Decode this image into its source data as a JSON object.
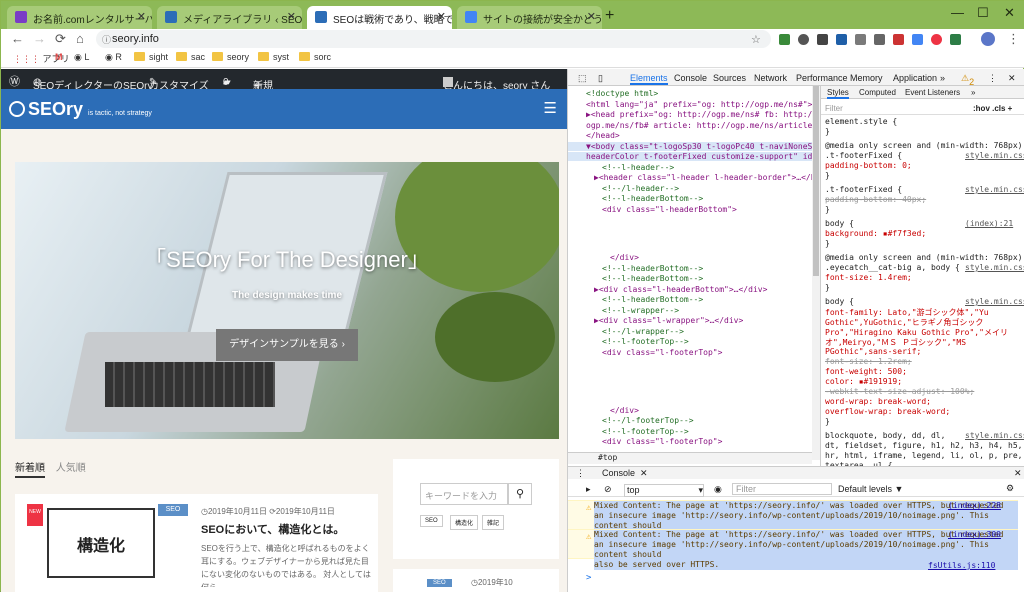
{
  "browser": {
    "tabs": [
      {
        "title": "お名前.comレンタルサーバー コント",
        "favicon_color": "#7a3cc6"
      },
      {
        "title": "メディアライブラリ ‹ SEOディレクター",
        "favicon_color": "#2c6db7"
      },
      {
        "title": "SEOは戦術であり、戦略ではない。",
        "favicon_color": "#2c6db7",
        "active": true
      },
      {
        "title": "サイトの接続が安全かどうかを確認",
        "favicon_color": "#4285f4"
      }
    ],
    "url": "seory.info",
    "bookmarks": [
      "アプリ",
      "M",
      "L",
      "R",
      "sight",
      "sac",
      "seory",
      "syst",
      "sorc"
    ]
  },
  "site": {
    "admin_bar": {
      "site_name": "SEOディレクターのSEOry",
      "customize": "カスタマイズ",
      "comments": "0",
      "new": "新規",
      "greeting": "こんにちは、seory さん"
    },
    "logo": "SEOry",
    "logo_tagline": "is tactic, not strategy",
    "hero": {
      "title": "「SEOry For The Designer」",
      "subtitle": "The design makes time",
      "button": "デザインサンプルを見る"
    },
    "feed_tabs": [
      "新着順",
      "人気順"
    ],
    "post": {
      "badge": "NEW",
      "category": "SEO",
      "date1": "2019年10月11日",
      "date2": "2019年10月11日",
      "title": "SEOにおいて、構造化とは。",
      "excerpt": "SEOを行う上で、構造化と呼ばれるものをよく耳にする。ウェブデザイナーから見れば見た目にない変化のないものではある。 対人としては何ら",
      "thumb_text": "構造化"
    },
    "sidebar": {
      "search_placeholder": "キーワードを入力",
      "tags": [
        "SEO",
        "構造化",
        "雑記"
      ],
      "date": "2019年10",
      "category": "SEO"
    }
  },
  "devtools": {
    "tabs": [
      "Elements",
      "Console",
      "Sources",
      "Network",
      "Performance",
      "Memory",
      "Application"
    ],
    "warning_count": "2",
    "dom_lines": [
      {
        "t": "<!doctype html>",
        "c": true,
        "i": 0
      },
      {
        "t": "<html lang=\"ja\" prefix=\"og: http://ogp.me/ns#\">",
        "i": 0
      },
      {
        "t": "▶<head prefix=\"og: http://ogp.me/ns# fb: http://",
        "i": 0
      },
      {
        "t": "ogp.me/ns/fb# article: http://ogp.me/ns/article#\">…",
        "i": 0
      },
      {
        "t": "</head>",
        "i": 0
      },
      {
        "t": "▼<body class=\"t-logoSp30 t-logoPc40 t-naviNoneSp t-",
        "i": 0,
        "sel": true
      },
      {
        "t": "headerColor t-footerFixed customize-support\" id=\"top\">",
        "i": 0,
        "sel": true
      },
      {
        "t": "<!--l-header-->",
        "c": true,
        "i": 2
      },
      {
        "t": "▶<header class=\"l-header l-header-border\">…</header>",
        "i": 1
      },
      {
        "t": "<!--/l-header-->",
        "c": true,
        "i": 2
      },
      {
        "t": "<!--l-headerBottom-->",
        "c": true,
        "i": 2
      },
      {
        "t": "<div class=\"l-headerBottom\">",
        "i": 2
      },
      {
        "t": "</div>",
        "i": 3,
        "gap": 4
      },
      {
        "t": "<!--l-headerBottom-->",
        "c": true,
        "i": 2
      },
      {
        "t": "<!--l-headerBottom-->",
        "c": true,
        "i": 2
      },
      {
        "t": "▶<div class=\"l-headerBottom\">…</div>",
        "i": 1
      },
      {
        "t": "<!--l-headerBottom-->",
        "c": true,
        "i": 2
      },
      {
        "t": "<!--l-wrapper-->",
        "c": true,
        "i": 2
      },
      {
        "t": "▶<div class=\"l-wrapper\">…</div>",
        "i": 1
      },
      {
        "t": "<!--/l-wrapper-->",
        "c": true,
        "i": 2
      },
      {
        "t": "<!--l-footerTop-->",
        "c": true,
        "i": 2
      },
      {
        "t": "<div class=\"l-footerTop\">",
        "i": 2
      },
      {
        "t": "</div>",
        "i": 3,
        "gap": 5
      },
      {
        "t": "<!--/l-footerTop-->",
        "c": true,
        "i": 2
      },
      {
        "t": "<!--l-footerTop-->",
        "c": true,
        "i": 2
      },
      {
        "t": "<div class=\"l-footerTop\">",
        "i": 2
      },
      {
        "t": "</div>",
        "i": 3,
        "gap": 2
      }
    ],
    "styles_tabs": [
      "Styles",
      "Computed",
      "Event Listeners"
    ],
    "filter_placeholder": "Filter",
    "filter_tools": ":hov .cls +",
    "styles_lines": [
      {
        "t": "element.style {",
        "k": "sel"
      },
      {
        "t": "}",
        "k": "sel"
      },
      {
        "t": "@media only screen and (min-width: 768px)",
        "k": "sel"
      },
      {
        "t": ".t-footerFixed {",
        "k": "sel",
        "src": "style.min.css:1"
      },
      {
        "t": "  padding-bottom: 0;",
        "k": "prop"
      },
      {
        "t": "}",
        "k": "sel"
      },
      {
        "t": ".t-footerFixed {",
        "k": "sel",
        "src": "style.min.css:1"
      },
      {
        "t": "  padding-bottom: 40px;",
        "k": "strike"
      },
      {
        "t": "}",
        "k": "sel"
      },
      {
        "t": "body {",
        "k": "sel",
        "src": "(index):21"
      },
      {
        "t": "  background: ▪#f7f3ed;",
        "k": "prop"
      },
      {
        "t": "}",
        "k": "sel"
      },
      {
        "t": "@media only screen and (min-width: 768px)",
        "k": "sel"
      },
      {
        "t": ".eyecatch__cat-big a, body {",
        "k": "sel",
        "src": "style.min.css:1"
      },
      {
        "t": "  font-size: 1.4rem;",
        "k": "prop"
      },
      {
        "t": "}",
        "k": "sel"
      },
      {
        "t": "body {",
        "k": "sel",
        "src": "style.min.css:1"
      },
      {
        "t": "  font-family: Lato,\"游ゴシック体\",\"Yu",
        "k": "prop"
      },
      {
        "t": "    Gothic\",YuGothic,\"ヒラギノ角ゴシック",
        "k": "prop"
      },
      {
        "t": "    Pro\",\"Hiragino Kaku Gothic Pro\",\"メイリ",
        "k": "prop"
      },
      {
        "t": "    オ\",Meiryo,\"ＭＳ Ｐゴシック\",\"MS",
        "k": "prop"
      },
      {
        "t": "    PGothic\",sans-serif;",
        "k": "prop"
      },
      {
        "t": "  font-size: 1.2rem;",
        "k": "strike"
      },
      {
        "t": "  font-weight: 500;",
        "k": "prop"
      },
      {
        "t": "  color: ▪#191919;",
        "k": "prop"
      },
      {
        "t": "  -webkit-text-size-adjust: 100%;",
        "k": "strike"
      },
      {
        "t": "  word-wrap: break-word;",
        "k": "prop"
      },
      {
        "t": "  overflow-wrap: break-word;",
        "k": "prop"
      },
      {
        "t": "}",
        "k": "sel"
      },
      {
        "t": "blockquote, body, dd, dl,",
        "k": "sel",
        "src": "style.min.css:1"
      },
      {
        "t": "dt, fieldset, figure, h1, h2, h3, h4, h5, h6,",
        "k": "sel"
      },
      {
        "t": "hr, html, iframe, legend, li, ol, p, pre,",
        "k": "sel"
      },
      {
        "t": "textarea, ul {",
        "k": "sel"
      },
      {
        "t": "  margin: ▸0;",
        "k": "prop"
      },
      {
        "t": "  padding: ▸0;",
        "k": "prop"
      },
      {
        "t": "}",
        "k": "sel"
      }
    ],
    "crumb": "#top",
    "console": {
      "title": "Console",
      "context": "top",
      "filter_placeholder": "Filter",
      "levels": "Default levels ▼",
      "warnings": [
        {
          "lines": [
            "Mixed Content: The page at 'https://seory.info/' was loaded over HTTPS, but requested",
            "an insecure image 'http://seory.info/wp-content/uploads/2019/10/noimage.png'. This content should",
            "also be served over HTTPS."
          ],
          "src": "(index):228"
        },
        {
          "lines": [
            "Mixed Content: The page at 'https://seory.info/' was loaded over HTTPS, but requested",
            "an insecure image 'http://seory.info/wp-content/uploads/2019/10/noimage.png'. This content should",
            "also be served over HTTPS."
          ],
          "src": "(index):300"
        }
      ],
      "last_src": "fsUtils.js:110",
      "prompt": ">"
    }
  }
}
